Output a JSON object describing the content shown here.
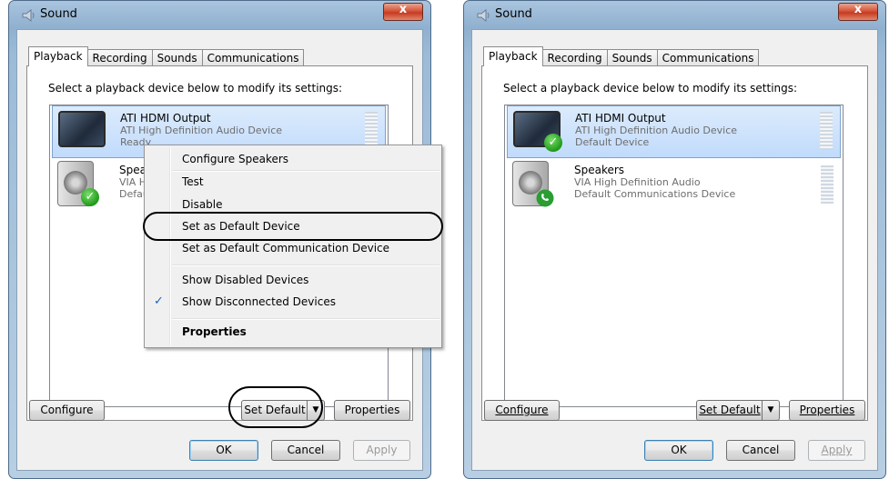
{
  "left": {
    "title": "Sound",
    "close_label": "x",
    "tabs": [
      "Playback",
      "Recording",
      "Sounds",
      "Communications"
    ],
    "instruction": "Select a playback device below to modify its settings:",
    "devices": [
      {
        "name": "ATI HDMI Output",
        "line1": "ATI High Definition Audio Device",
        "line2": "Ready"
      },
      {
        "name": "Speakers",
        "line1": "VIA High Definition Audio",
        "line2": "Default Device"
      }
    ],
    "context_menu": {
      "items": [
        "Configure Speakers",
        "Test",
        "Disable",
        "Set as Default Device",
        "Set as Default Communication Device",
        "Show Disabled Devices",
        "Show Disconnected Devices",
        "Properties"
      ]
    },
    "buttons": {
      "configure": "Configure",
      "set_default": "Set Default",
      "properties": "Properties",
      "ok": "OK",
      "cancel": "Cancel",
      "apply": "Apply"
    }
  },
  "right": {
    "title": "Sound",
    "close_label": "x",
    "tabs": [
      "Playback",
      "Recording",
      "Sounds",
      "Communications"
    ],
    "instruction": "Select a playback device below to modify its settings:",
    "devices": [
      {
        "name": "ATI HDMI Output",
        "line1": "ATI High Definition Audio Device",
        "line2": "Default Device"
      },
      {
        "name": "Speakers",
        "line1": "VIA High Definition Audio",
        "line2": "Default Communications Device"
      }
    ],
    "buttons": {
      "configure": "Configure",
      "set_default": "Set Default",
      "properties": "Properties",
      "ok": "OK",
      "cancel": "Cancel",
      "apply": "Apply"
    }
  },
  "icons": {
    "check": "✓",
    "dropdown": "▼",
    "menu_check": "✓"
  }
}
